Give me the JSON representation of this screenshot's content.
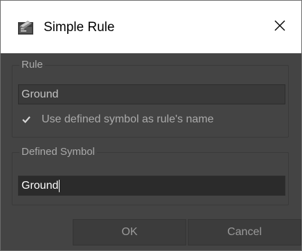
{
  "window": {
    "title": "Simple Rule",
    "icon": "app-icon",
    "close_icon": "close-icon"
  },
  "rule_group": {
    "legend": "Rule",
    "value": "Ground",
    "checkbox": {
      "checked": true,
      "label": "Use defined symbol as rule's name"
    }
  },
  "symbol_group": {
    "legend": "Defined Symbol",
    "value": "Ground"
  },
  "buttons": {
    "ok": "OK",
    "cancel": "Cancel"
  },
  "colors": {
    "dialog_background": "#444444",
    "titlebar_background": "#ffffff",
    "text_muted": "#aaaaaa"
  }
}
